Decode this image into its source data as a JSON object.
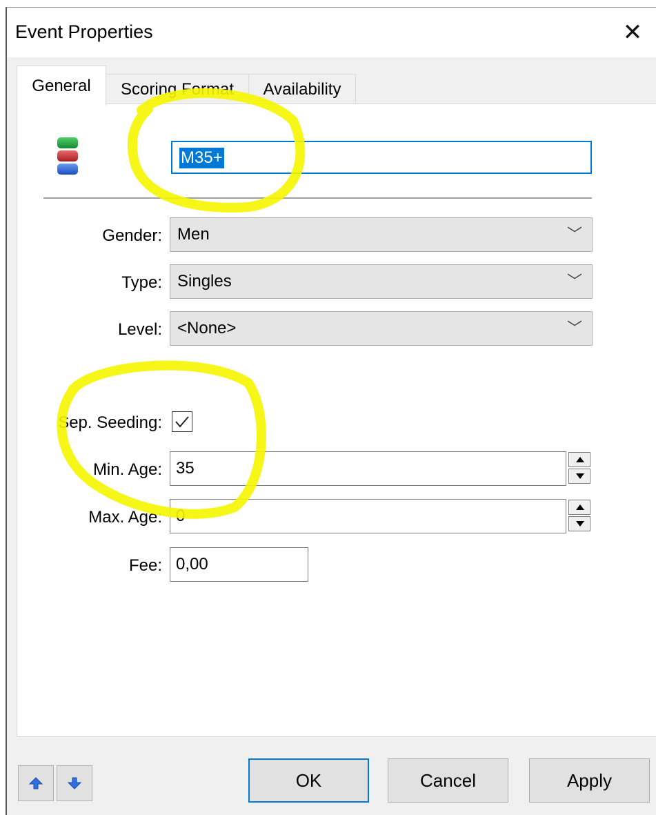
{
  "window": {
    "title": "Event Properties"
  },
  "tabs": [
    {
      "label": "General",
      "active": true
    },
    {
      "label": "Scoring Format",
      "active": false
    },
    {
      "label": "Availability",
      "active": false
    }
  ],
  "general": {
    "event_name": "M35+",
    "gender": {
      "label": "Gender:",
      "value": "Men"
    },
    "type": {
      "label": "Type:",
      "value": "Singles"
    },
    "level": {
      "label": "Level:",
      "value": "<None>"
    },
    "sep_seeding": {
      "label": "Sep. Seeding:",
      "checked": true
    },
    "min_age": {
      "label": "Min. Age:",
      "value": "35"
    },
    "max_age": {
      "label": "Max. Age:",
      "value": "0"
    },
    "fee": {
      "label": "Fee:",
      "value": "0,00"
    }
  },
  "buttons": {
    "ok": "OK",
    "cancel": "Cancel",
    "apply": "Apply"
  },
  "icons": {
    "close": "close-icon",
    "event": "event-icon",
    "up": "arrow-up-icon",
    "down": "arrow-down-icon",
    "chevron": "chevron-down-icon",
    "check": "checkmark-icon"
  },
  "colors": {
    "selection": "#0078d7",
    "highlight_marker": "#ffff00",
    "icon_green": "#1a9e3a",
    "icon_red": "#c0282d",
    "icon_blue": "#1f5fd6"
  }
}
